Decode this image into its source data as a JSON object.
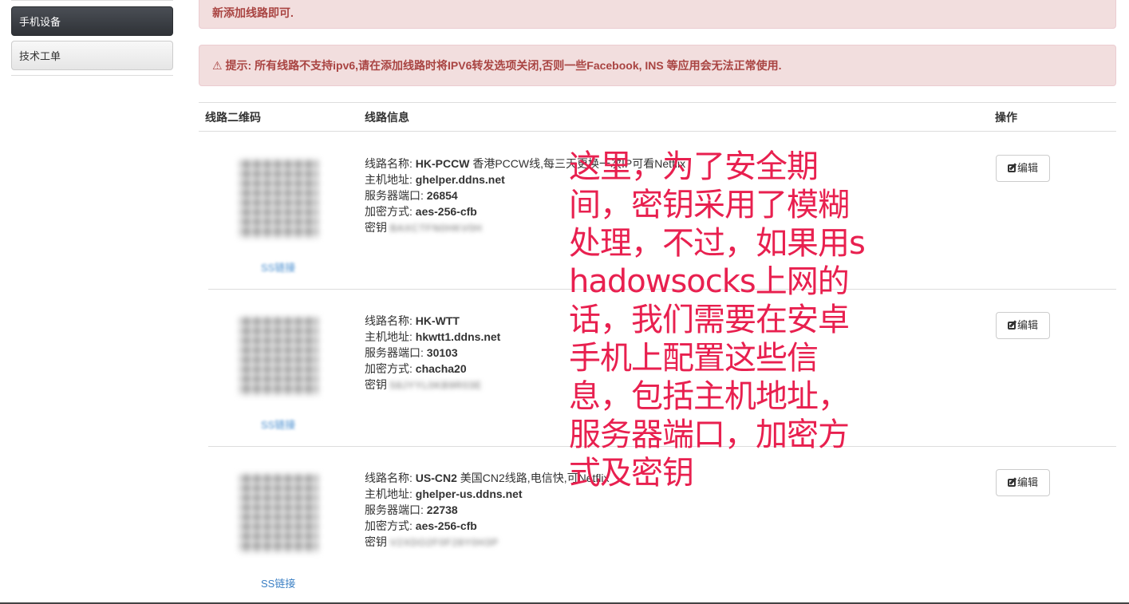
{
  "sidebar": {
    "items": [
      {
        "label": "手机设备",
        "active": true
      },
      {
        "label": "技术工单",
        "active": false
      }
    ]
  },
  "alerts": {
    "top_text": "新添加线路即可.",
    "notice_prefix": "提示:",
    "notice_text": "所有线路不支持ipv6,请在添加线路时将IPV6转发选项关闭,否则一些Facebook, INS 等应用会无法正常使用.",
    "warning_icon": "warning-triangle-icon"
  },
  "table": {
    "headers": {
      "qr": "线路二维码",
      "info": "线路信息",
      "op": "操作"
    },
    "labels": {
      "name": "线路名称:",
      "host": "主机地址:",
      "port": "服务器端口:",
      "method": "加密方式:",
      "key": "密钥"
    },
    "edit_label": "编辑",
    "ss_link_label": "SS链接",
    "rows": [
      {
        "name": "HK-PCCW",
        "desc": "香港PCCW线,每三天更换一次IP可看Netflix",
        "host": "ghelper.ddns.net",
        "port": "26854",
        "method": "aes-256-cfb",
        "key": "BAXCTFN0HKV0H"
      },
      {
        "name": "HK-WTT",
        "desc": "",
        "host": "hkwtt1.ddns.net",
        "port": "30103",
        "method": "chacha20",
        "key": "58JYYL0KB9R03E"
      },
      {
        "name": "US-CN2",
        "desc": "美国CN2线路,电信快,可Netflix",
        "host": "ghelper-us.ddns.net",
        "port": "22738",
        "method": "aes-256-cfb",
        "key": "V2XDO2F0F28Y0H3P"
      }
    ]
  },
  "annotation": {
    "text": "这里，为了安全期间，密钥采用了模糊处理，不过，如果用shadowsocks上网的话，我们需要在安卓手机上配置这些信息，包括主机地址，服务器端口，加密方式及密钥",
    "color": "#e8204f"
  }
}
